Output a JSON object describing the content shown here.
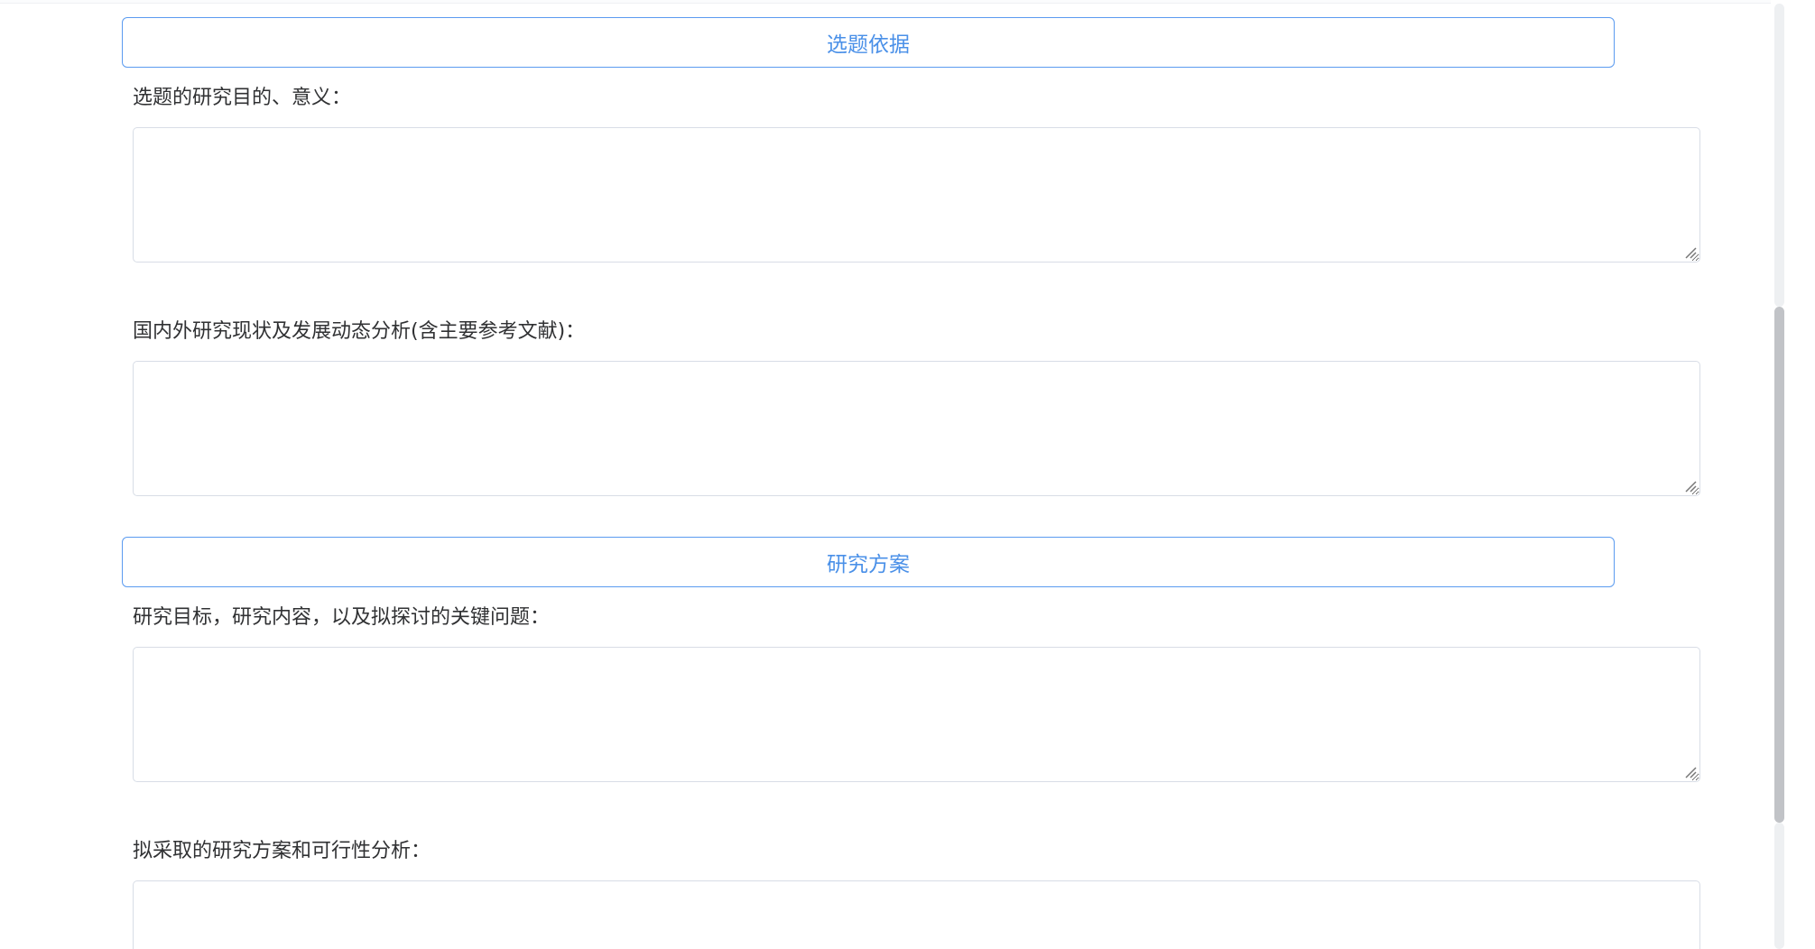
{
  "sections": [
    {
      "header": "选题依据",
      "fields": [
        {
          "label": "选题的研究目的、意义：",
          "value": ""
        },
        {
          "label": "国内外研究现状及发展动态分析(含主要参考文献)：",
          "value": ""
        }
      ]
    },
    {
      "header": "研究方案",
      "fields": [
        {
          "label": "研究目标，研究内容，以及拟探讨的关键问题：",
          "value": ""
        },
        {
          "label": "拟采取的研究方案和可行性分析：",
          "value": ""
        }
      ]
    }
  ],
  "colors": {
    "accent": "#4a90e8",
    "header_border": "#5b9bf0",
    "label_text": "#303133",
    "textarea_border": "#d8dde6",
    "scrollbar_thumb": "#c1c3c7"
  },
  "icons": {
    "resize_grip": "resize-grip-icon"
  }
}
